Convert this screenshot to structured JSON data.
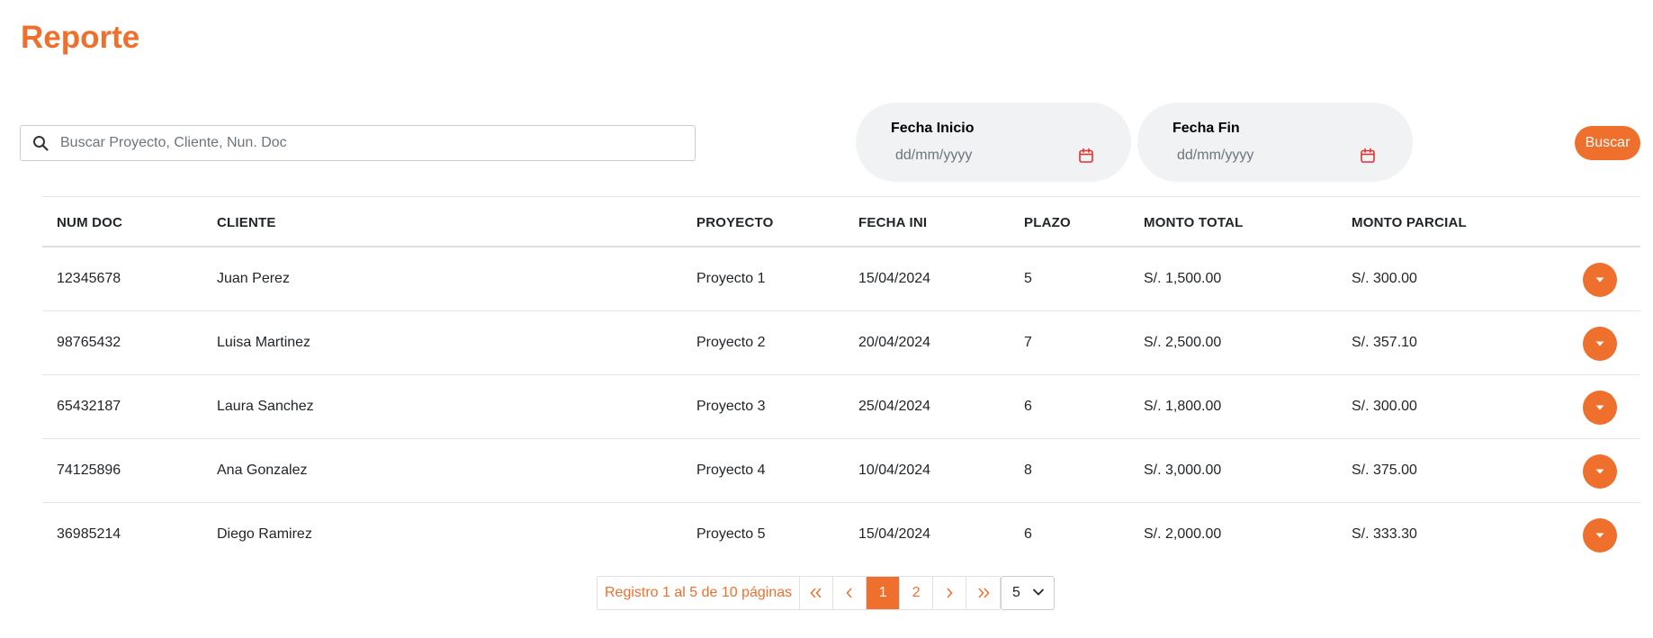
{
  "page_title": "Reporte",
  "search": {
    "placeholder": "Buscar Proyecto, Cliente, Nun. Doc"
  },
  "date_start": {
    "label": "Fecha Inicio",
    "placeholder": "dd/mm/yyyy"
  },
  "date_end": {
    "label": "Fecha Fin",
    "placeholder": "dd/mm/yyyy"
  },
  "search_button": "Buscar",
  "table": {
    "headers": [
      "NUM DOC",
      "CLIENTE",
      "PROYECTO",
      "FECHA INI",
      "PLAZO",
      "MONTO TOTAL",
      "MONTO PARCIAL"
    ],
    "rows": [
      [
        "12345678",
        "Juan Perez",
        "Proyecto 1",
        "15/04/2024",
        "5",
        "S/. 1,500.00",
        "S/. 300.00"
      ],
      [
        "98765432",
        "Luisa Martinez",
        "Proyecto 2",
        "20/04/2024",
        "7",
        "S/. 2,500.00",
        "S/. 357.10"
      ],
      [
        "65432187",
        "Laura Sanchez",
        "Proyecto 3",
        "25/04/2024",
        "6",
        "S/. 1,800.00",
        "S/. 300.00"
      ],
      [
        "74125896",
        "Ana Gonzalez",
        "Proyecto 4",
        "10/04/2024",
        "8",
        "S/. 3,000.00",
        "S/. 375.00"
      ],
      [
        "36985214",
        "Diego Ramirez",
        "Proyecto 5",
        "15/04/2024",
        "6",
        "S/. 2,000.00",
        "S/. 333.30"
      ]
    ]
  },
  "pagination": {
    "info": "Registro 1 al 5 de 10 páginas",
    "first": "«",
    "prev": "‹",
    "pages": [
      "1",
      "2"
    ],
    "current_page": "1",
    "next": "›",
    "last": "»",
    "page_size": "5"
  },
  "colors": {
    "accent": "#ef6f2c",
    "pill_bg": "#f1f2f4"
  },
  "icons": {
    "search": "search-icon",
    "calendar": "calendar-icon",
    "expand": "caret-down-icon",
    "page_size": "chevron-down-icon"
  }
}
